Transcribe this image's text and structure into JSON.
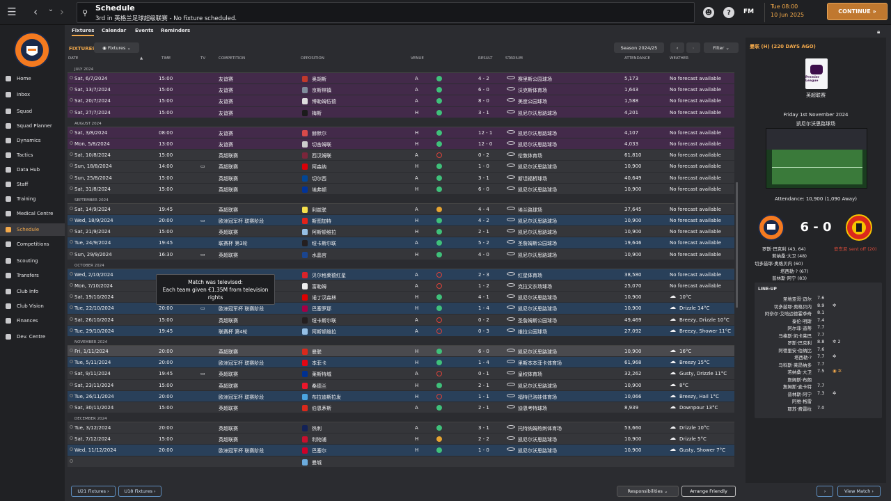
{
  "topbar": {
    "title": "Schedule",
    "subtitle": "3rd in 英格兰足球超级联赛 - No fixture scheduled.",
    "fm_label": "FM",
    "time": "Tue 08:00",
    "date": "10 Jun 2025",
    "continue_label": "CONTINUE"
  },
  "sidebar": {
    "items": [
      {
        "label": "Home"
      },
      {
        "label": "Inbox"
      },
      {
        "label": "Squad"
      },
      {
        "label": "Squad Planner"
      },
      {
        "label": "Dynamics"
      },
      {
        "label": "Tactics"
      },
      {
        "label": "Data Hub"
      },
      {
        "label": "Staff"
      },
      {
        "label": "Training"
      },
      {
        "label": "Medical Centre"
      },
      {
        "label": "Schedule"
      },
      {
        "label": "Competitions"
      },
      {
        "label": "Scouting"
      },
      {
        "label": "Transfers"
      },
      {
        "label": "Club Info"
      },
      {
        "label": "Club Vision"
      },
      {
        "label": "Finances"
      },
      {
        "label": "Dev. Centre"
      }
    ],
    "active": "Schedule"
  },
  "tabs": [
    "Fixtures",
    "Calendar",
    "Events",
    "Reminders"
  ],
  "toolbar": {
    "section_label": "FIXTURES",
    "view_select": "Fixtures",
    "season": "Season 2024/25",
    "filter": "Filter"
  },
  "columns": {
    "date": "DATE",
    "time": "TIME",
    "tv": "TV",
    "competition": "COMPETITION",
    "opposition": "OPPOSITION",
    "venue": "VENUE",
    "result": "RESULT",
    "stadium": "STADIUM",
    "attendance": "ATTENDANCE",
    "weather": "WEATHER"
  },
  "months": [
    {
      "label": "JULY 2024",
      "rows": [
        {
          "date": "Sat, 6/7/2024",
          "time": "15:00",
          "tv": false,
          "comp": "友谊赛",
          "opp": "奥胡斯",
          "venue": "A",
          "res": "W",
          "score": "4 - 2",
          "stadium": "赛里斯公园球场",
          "att": "5,173",
          "weather": "No forecast available",
          "type": "friendly",
          "badge": "#c0392b"
        },
        {
          "date": "Sat, 13/7/2024",
          "time": "15:00",
          "tv": false,
          "comp": "友谊赛",
          "opp": "京斯林镇",
          "venue": "A",
          "res": "W",
          "score": "6 - 0",
          "stadium": "沃克斯体育场",
          "att": "1,643",
          "weather": "No forecast available",
          "type": "friendly",
          "badge": "#7f8c9a"
        },
        {
          "date": "Sat, 20/7/2024",
          "time": "15:00",
          "tv": false,
          "comp": "友谊赛",
          "opp": "博勒姆伍德",
          "venue": "A",
          "res": "W",
          "score": "8 - 0",
          "stadium": "美度公园球场",
          "att": "1,588",
          "weather": "No forecast available",
          "type": "friendly",
          "badge": "#dddddd"
        },
        {
          "date": "Sat, 27/7/2024",
          "time": "15:00",
          "tv": false,
          "comp": "友谊赛",
          "opp": "梅斯",
          "venue": "H",
          "res": "W",
          "score": "3 - 1",
          "stadium": "凯尼尔沃思路球场",
          "att": "4,201",
          "weather": "No forecast available",
          "type": "friendly",
          "badge": "#1b1b1b"
        }
      ]
    },
    {
      "label": "AUGUST 2024",
      "rows": [
        {
          "date": "Sat, 3/8/2024",
          "time": "08:00",
          "tv": false,
          "comp": "友谊赛",
          "opp": "赫默尔",
          "venue": "H",
          "res": "W",
          "score": "12 - 1",
          "stadium": "凯尼尔沃思路球场",
          "att": "4,107",
          "weather": "No forecast available",
          "type": "friendly",
          "badge": "#d94a4a"
        },
        {
          "date": "Mon, 5/8/2024",
          "time": "13:00",
          "tv": false,
          "comp": "友谊赛",
          "opp": "切舍姆联",
          "venue": "H",
          "res": "W",
          "score": "12 - 0",
          "stadium": "凯尼尔沃思路球场",
          "att": "4,033",
          "weather": "No forecast available",
          "type": "friendly",
          "badge": "#cccccc"
        },
        {
          "date": "Sat, 10/8/2024",
          "time": "15:00",
          "tv": false,
          "comp": "英超联赛",
          "opp": "西汉姆联",
          "venue": "A",
          "res": "L",
          "score": "0 - 2",
          "stadium": "伦敦体育场",
          "att": "61,810",
          "weather": "No forecast available",
          "type": "league",
          "badge": "#7a263a"
        },
        {
          "date": "Sun, 18/8/2024",
          "time": "14:00",
          "tv": true,
          "comp": "英超联赛",
          "opp": "阿森纳",
          "venue": "H",
          "res": "W",
          "score": "1 - 0",
          "stadium": "凯尼尔沃思路球场",
          "att": "10,900",
          "weather": "No forecast available",
          "type": "league",
          "badge": "#db0007"
        },
        {
          "date": "Sun, 25/8/2024",
          "time": "15:00",
          "tv": false,
          "comp": "英超联赛",
          "opp": "切尔西",
          "venue": "A",
          "res": "W",
          "score": "3 - 1",
          "stadium": "斯坦福桥球场",
          "att": "40,649",
          "weather": "No forecast available",
          "type": "league",
          "badge": "#034694"
        },
        {
          "date": "Sat, 31/8/2024",
          "time": "15:00",
          "tv": false,
          "comp": "英超联赛",
          "opp": "埃弗顿",
          "venue": "H",
          "res": "W",
          "score": "6 - 0",
          "stadium": "凯尼尔沃思路球场",
          "att": "10,900",
          "weather": "No forecast available",
          "type": "league",
          "badge": "#003399"
        }
      ]
    },
    {
      "label": "SEPTEMBER 2024",
      "rows": [
        {
          "date": "Sat, 14/9/2024",
          "time": "19:45",
          "tv": false,
          "comp": "英超联赛",
          "opp": "利兹联",
          "venue": "A",
          "res": "D",
          "score": "4 - 4",
          "stadium": "埃兰路球场",
          "att": "37,645",
          "weather": "No forecast available",
          "type": "league",
          "badge": "#f5e04b"
        },
        {
          "date": "Wed, 18/9/2024",
          "time": "20:00",
          "tv": true,
          "comp": "欧洲冠军杯 联赛阶段",
          "opp": "斯图加特",
          "venue": "H",
          "res": "W",
          "score": "4 - 2",
          "stadium": "凯尼尔沃思路球场",
          "att": "10,900",
          "weather": "No forecast available",
          "type": "cup",
          "badge": "#e32219"
        },
        {
          "date": "Sat, 21/9/2024",
          "time": "15:00",
          "tv": false,
          "comp": "英超联赛",
          "opp": "阿斯顿维拉",
          "venue": "H",
          "res": "W",
          "score": "2 - 1",
          "stadium": "凯尼尔沃思路球场",
          "att": "10,900",
          "weather": "No forecast available",
          "type": "league",
          "badge": "#95bfe5"
        },
        {
          "date": "Tue, 24/9/2024",
          "time": "19:45",
          "tv": false,
          "comp": "联赛杯 第3轮",
          "opp": "纽卡斯尔联",
          "venue": "A",
          "res": "W",
          "score": "5 - 2",
          "stadium": "圣詹姆斯公园球场",
          "att": "19,646",
          "weather": "No forecast available",
          "type": "cup",
          "badge": "#241f20"
        },
        {
          "date": "Sun, 29/9/2024",
          "time": "16:30",
          "tv": true,
          "comp": "英超联赛",
          "opp": "水晶宫",
          "venue": "H",
          "res": "W",
          "score": "4 - 0",
          "stadium": "凯尼尔沃思路球场",
          "att": "10,900",
          "weather": "No forecast available",
          "type": "league",
          "badge": "#1b458f"
        }
      ]
    },
    {
      "label": "OCTOBER 2024",
      "rows": [
        {
          "date": "Wed, 2/10/2024",
          "time": "",
          "tv": false,
          "comp": "",
          "opp": "贝尔格莱德红星",
          "venue": "A",
          "res": "L",
          "score": "2 - 3",
          "stadium": "红星体育场",
          "att": "38,580",
          "weather": "No forecast available",
          "type": "cup",
          "badge": "#d8232a"
        },
        {
          "date": "Mon, 7/10/2024",
          "time": "",
          "tv": false,
          "comp": "",
          "opp": "富勒姆",
          "venue": "A",
          "res": "L",
          "score": "1 - 2",
          "stadium": "克拉文农场球场",
          "att": "25,070",
          "weather": "No forecast available",
          "type": "league",
          "badge": "#eeeeee"
        },
        {
          "date": "Sat, 19/10/2024",
          "time": "15:00",
          "tv": false,
          "comp": "英超联赛",
          "opp": "诺丁汉森林",
          "venue": "H",
          "res": "W",
          "score": "4 - 1",
          "stadium": "凯尼尔沃思路球场",
          "att": "10,900",
          "weather": "10°C",
          "type": "league",
          "badge": "#dd0000"
        },
        {
          "date": "Tue, 22/10/2024",
          "time": "20:00",
          "tv": true,
          "comp": "欧洲冠军杯 联赛阶段",
          "opp": "巴塞罗那",
          "venue": "H",
          "res": "W",
          "score": "1 - 4",
          "stadium": "凯尼尔沃思路球场",
          "att": "10,900",
          "weather": "Drizzle 14°C",
          "type": "cup",
          "badge": "#a50044"
        },
        {
          "date": "Sat, 26/10/2024",
          "time": "15:00",
          "tv": false,
          "comp": "英超联赛",
          "opp": "纽卡斯尔联",
          "venue": "A",
          "res": "L",
          "score": "0 - 2",
          "stadium": "圣詹姆斯公园球场",
          "att": "49,469",
          "weather": "Breezy, Drizzle 10°C",
          "type": "league",
          "badge": "#241f20"
        },
        {
          "date": "Tue, 29/10/2024",
          "time": "19:45",
          "tv": false,
          "comp": "联赛杯 第4轮",
          "opp": "阿斯顿维拉",
          "venue": "A",
          "res": "L",
          "score": "0 - 3",
          "stadium": "维拉公园球场",
          "att": "27,092",
          "weather": "Breezy, Shower 11°C",
          "type": "cup",
          "badge": "#95bfe5"
        }
      ]
    },
    {
      "label": "NOVEMBER 2024",
      "rows": [
        {
          "date": "Fri, 1/11/2024",
          "time": "20:00",
          "tv": false,
          "comp": "英超联赛",
          "opp": "曼联",
          "venue": "H",
          "res": "W",
          "score": "6 - 0",
          "stadium": "凯尼尔沃思路球场",
          "att": "10,900",
          "weather": "16°C",
          "type": "hl",
          "badge": "#da291c"
        },
        {
          "date": "Tue, 5/11/2024",
          "time": "20:00",
          "tv": false,
          "comp": "欧洲冠军杯 联赛阶段",
          "opp": "本菲卡",
          "venue": "H",
          "res": "W",
          "score": "1 - 4",
          "stadium": "里斯本本菲卡体育场",
          "att": "61,968",
          "weather": "Breezy 15°C",
          "type": "cup",
          "badge": "#e30613"
        },
        {
          "date": "Sat, 9/11/2024",
          "time": "19:45",
          "tv": true,
          "comp": "英超联赛",
          "opp": "莱斯特城",
          "venue": "A",
          "res": "L",
          "score": "0 - 1",
          "stadium": "皇权体育场",
          "att": "32,262",
          "weather": "Gusty, Drizzle 11°C",
          "type": "league",
          "badge": "#003090"
        },
        {
          "date": "Sat, 23/11/2024",
          "time": "15:00",
          "tv": false,
          "comp": "英超联赛",
          "opp": "桑德兰",
          "venue": "H",
          "res": "W",
          "score": "2 - 1",
          "stadium": "凯尼尔沃思路球场",
          "att": "10,900",
          "weather": "8°C",
          "type": "league",
          "badge": "#eb172b"
        },
        {
          "date": "Tue, 26/11/2024",
          "time": "20:00",
          "tv": false,
          "comp": "欧洲冠军杯 联赛阶段",
          "opp": "布拉迪斯拉发",
          "venue": "H",
          "res": "L",
          "score": "1 - 1",
          "stadium": "福特巴洛娃体育场",
          "att": "10,066",
          "weather": "Breezy, Hail 1°C",
          "type": "cup",
          "badge": "#4aa3df"
        },
        {
          "date": "Sat, 30/11/2024",
          "time": "15:00",
          "tv": false,
          "comp": "英超联赛",
          "opp": "伯恩茅斯",
          "venue": "A",
          "res": "W",
          "score": "2 - 1",
          "stadium": "迪恩考特球场",
          "att": "8,939",
          "weather": "Downpour 13°C",
          "type": "league",
          "badge": "#da291c"
        }
      ]
    },
    {
      "label": "DECEMBER 2024",
      "rows": [
        {
          "date": "Tue, 3/12/2024",
          "time": "20:00",
          "tv": false,
          "comp": "英超联赛",
          "opp": "热刺",
          "venue": "A",
          "res": "W",
          "score": "3 - 1",
          "stadium": "托特纳姆热刺体育场",
          "att": "53,660",
          "weather": "Drizzle 10°C",
          "type": "league",
          "badge": "#132257"
        },
        {
          "date": "Sat, 7/12/2024",
          "time": "15:00",
          "tv": false,
          "comp": "英超联赛",
          "opp": "利物浦",
          "venue": "H",
          "res": "D",
          "score": "2 - 2",
          "stadium": "凯尼尔沃思路球场",
          "att": "10,900",
          "weather": "Drizzle 5°C",
          "type": "league",
          "badge": "#c8102e"
        },
        {
          "date": "Wed, 11/12/2024",
          "time": "20:00",
          "tv": false,
          "comp": "欧洲冠军杯 联赛阶段",
          "opp": "巴塞尔",
          "venue": "H",
          "res": "W",
          "score": "1 - 0",
          "stadium": "凯尼尔沃思路球场",
          "att": "10,900",
          "weather": "Gusty, Shower 7°C",
          "type": "cup",
          "badge": "#d00027"
        },
        {
          "date": "",
          "time": "",
          "tv": false,
          "comp": "",
          "opp": "曼城",
          "venue": "",
          "res": "",
          "score": "",
          "stadium": "",
          "att": "",
          "weather": "",
          "type": "league",
          "badge": "#6cabdd"
        }
      ]
    }
  ],
  "tooltip": {
    "line1": "Match was televised:",
    "line2": "Each team given €1.35M from television",
    "line3": "rights"
  },
  "bottom": {
    "u21": "U21 Fixtures",
    "u18": "U18 Fixtures",
    "responsibilities": "Responsibilities",
    "arrange": "Arrange Friendly"
  },
  "panel": {
    "heading": "曼联 (H) (220 DAYS AGO)",
    "league_logo_text": "Premier League",
    "competition": "英超联赛",
    "date": "Friday 1st November 2024",
    "stadium": "凯尼尔沃思路球场",
    "attendance": "Attendance: 10,900 (1,090 Away)",
    "score": "6 - 0",
    "home_scorers": [
      "罗斯·巴克利 (43, 64)",
      "若纳桑·大卫 (48)",
      "切多兹耶·奥格贝内 (60)",
      "塔西勒·? (67)",
      "普林斯·阿宁 (83)"
    ],
    "away_event": "安东尼 sent off (20)",
    "lineup_title": "LINE-UP",
    "lineup": [
      {
        "name": "圣地亚哥·迈尔",
        "rating": "7.6",
        "extra": ""
      },
      {
        "name": "切多兹耶·奥格贝内",
        "rating": "8.9",
        "extra": "cog"
      },
      {
        "name": "阿奈尔·艾哈迈德霍季奇",
        "rating": "8.1",
        "extra": ""
      },
      {
        "name": "泰伦·明斯",
        "rating": "7.4",
        "extra": ""
      },
      {
        "name": "阿尔菲·道蒂",
        "rating": "7.7",
        "extra": ""
      },
      {
        "name": "马格斯·凯卡莱巴",
        "rating": "7.7",
        "extra": ""
      },
      {
        "name": "罗斯·巴克利",
        "rating": "8.8",
        "extra": "cog 2"
      },
      {
        "name": "阿德里安·伯纳比",
        "rating": "7.6",
        "extra": ""
      },
      {
        "name": "塔西勒·?",
        "rating": "7.7",
        "extra": "cog"
      },
      {
        "name": "马科斯·莱昂纳多",
        "rating": "7.7",
        "extra": ""
      },
      {
        "name": "若纳桑·大卫",
        "rating": "7.5",
        "extra": "sub cog"
      },
      {
        "name": "詹姆斯·布朗",
        "rating": "",
        "extra": ""
      },
      {
        "name": "詹姆斯·麦卡特",
        "rating": "7.7",
        "extra": ""
      },
      {
        "name": "普林斯·阿宁",
        "rating": "7.3",
        "extra": "cog"
      },
      {
        "name": "阿维·格雷",
        "rating": "",
        "extra": ""
      },
      {
        "name": "耶苏·费雷拉",
        "rating": "7.0",
        "extra": ""
      }
    ],
    "view_match": "View Match"
  }
}
